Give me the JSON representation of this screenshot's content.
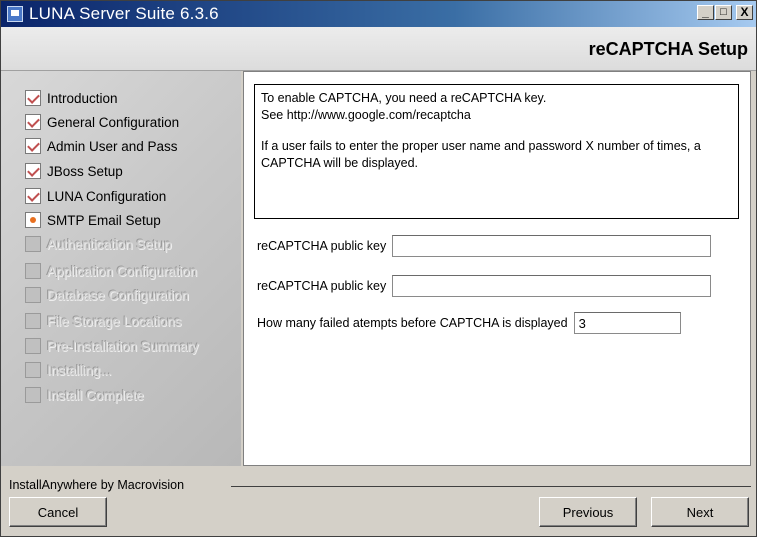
{
  "window": {
    "title": "LUNA Server Suite 6.3.6",
    "min_label": "_",
    "max_label": "□",
    "close_label": "X"
  },
  "header": {
    "title": "reCAPTCHA Setup"
  },
  "steps": [
    {
      "label": "Introduction",
      "state": "done"
    },
    {
      "label": "General Configuration",
      "state": "done"
    },
    {
      "label": "Admin User and Pass",
      "state": "done"
    },
    {
      "label": "JBoss Setup",
      "state": "done"
    },
    {
      "label": "LUNA Configuration",
      "state": "done"
    },
    {
      "label": "SMTP Email Setup",
      "state": "current"
    },
    {
      "label": "Authentication Setup",
      "state": "pending"
    },
    {
      "label": "Application Configuration",
      "state": "pending"
    },
    {
      "label": "Database Configuration",
      "state": "pending"
    },
    {
      "label": "File Storage Locations",
      "state": "pending"
    },
    {
      "label": "Pre-Installation Summary",
      "state": "pending"
    },
    {
      "label": "Installing...",
      "state": "pending"
    },
    {
      "label": "Install Complete",
      "state": "pending"
    }
  ],
  "info": {
    "line1": "To enable CAPTCHA, you need a reCAPTCHA key.",
    "line2": "See http://www.google.com/recaptcha",
    "line3": "If a user fails to enter the proper user name and password X number of times, a CAPTCHA will be displayed."
  },
  "form": {
    "public_key_label": "reCAPTCHA public key",
    "public_key_value": "",
    "public_key2_label": "reCAPTCHA public key",
    "public_key2_value": "",
    "attempts_label": "How many failed atempts before CAPTCHA is displayed",
    "attempts_value": "3"
  },
  "footer": {
    "brand": "InstallAnywhere by Macrovision",
    "cancel": "Cancel",
    "previous": "Previous",
    "next": "Next"
  }
}
